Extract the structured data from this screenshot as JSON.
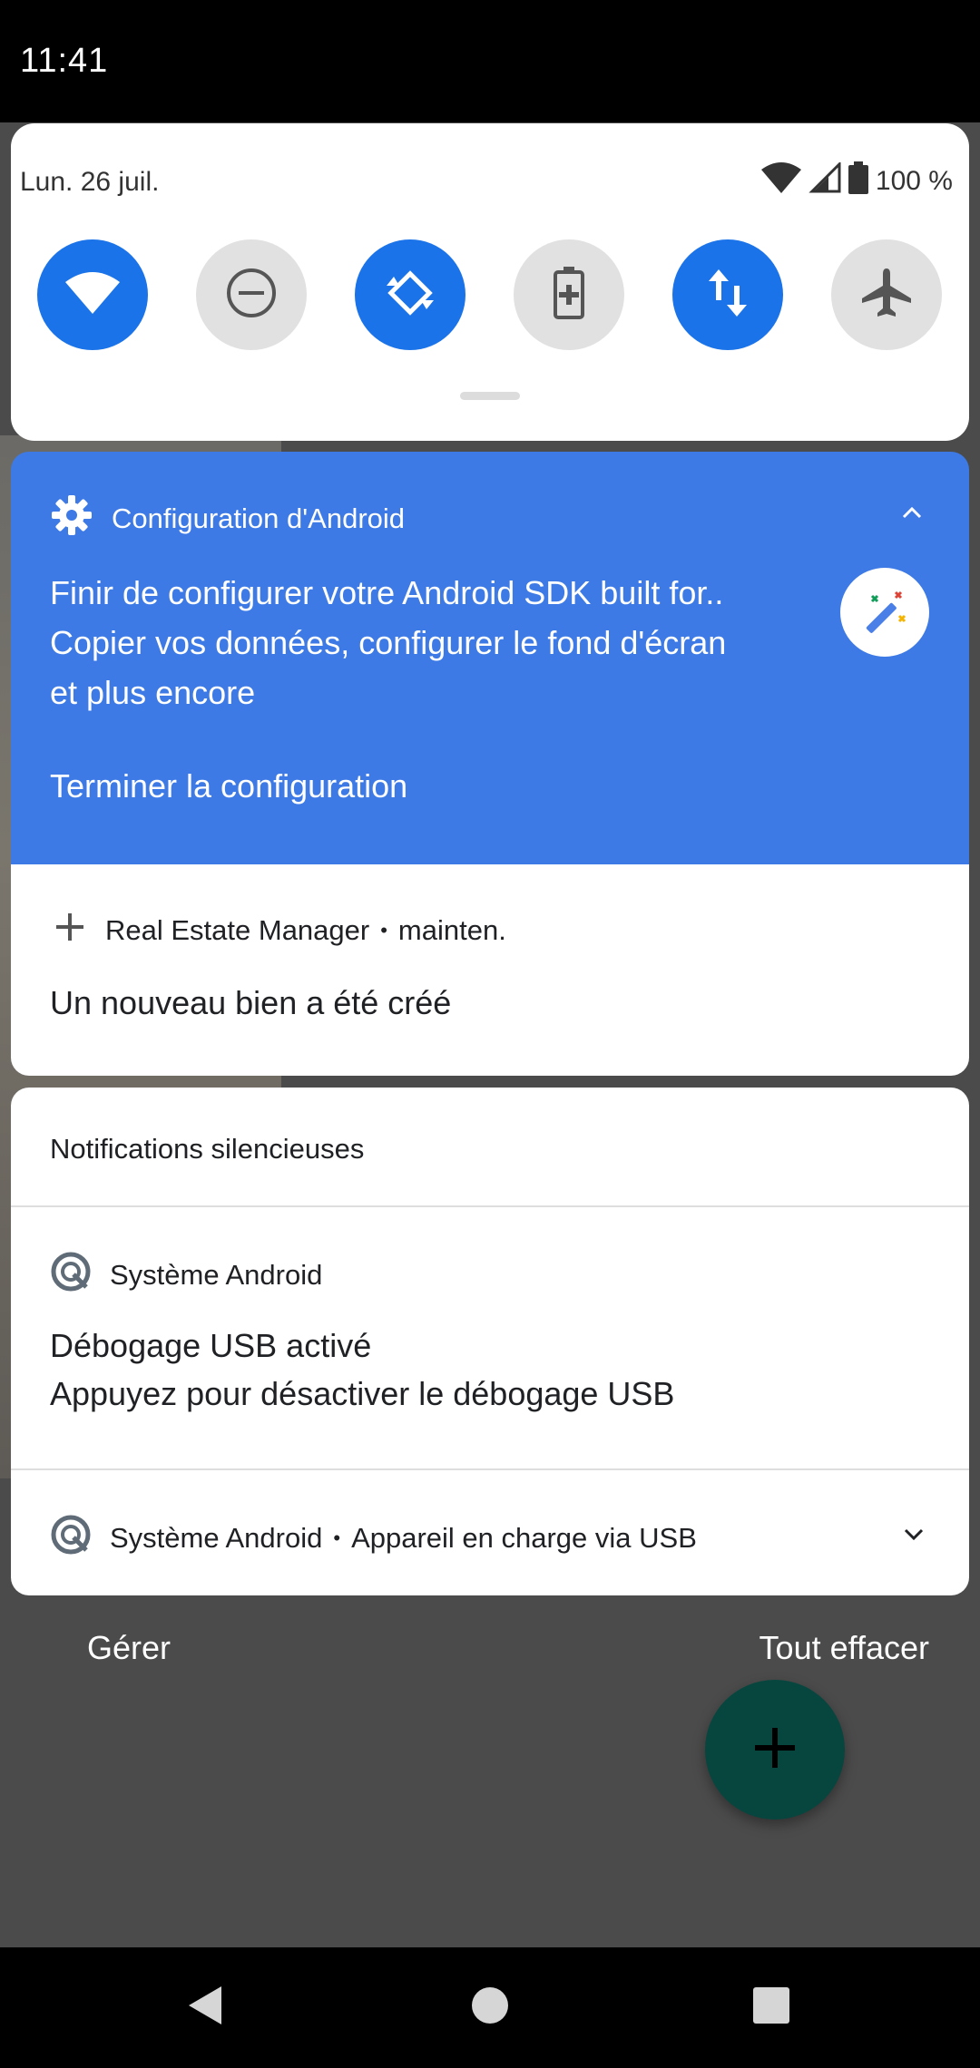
{
  "status_bar": {
    "time": "11:41"
  },
  "quick_settings": {
    "date": "Lun. 26 juil.",
    "battery": "100 %",
    "tiles": [
      {
        "name": "wifi",
        "icon": "wifi-icon",
        "active": true
      },
      {
        "name": "do-not-disturb",
        "icon": "minus-circle-icon",
        "active": false
      },
      {
        "name": "auto-rotate",
        "icon": "rotate-icon",
        "active": true
      },
      {
        "name": "battery-saver",
        "icon": "battery-plus-icon",
        "active": false
      },
      {
        "name": "mobile-data",
        "icon": "data-arrows-icon",
        "active": true
      },
      {
        "name": "airplane-mode",
        "icon": "airplane-icon",
        "active": false
      }
    ]
  },
  "setup_notification": {
    "app": "Configuration d'Android",
    "line1": "Finir de configurer votre Android SDK built for..",
    "line2": "Copier vos données, configurer le fond d'écran",
    "line3": "et plus encore",
    "action": "Terminer la configuration",
    "icon": "magic-wand-icon"
  },
  "rem_notification": {
    "app": "Real Estate Manager",
    "time": "mainten.",
    "text": "Un nouveau bien a été créé"
  },
  "silent": {
    "title": "Notifications silencieuses",
    "usb_debug": {
      "app": "Système Android",
      "title": "Débogage USB activé",
      "text": "Appuyez pour désactiver le débogage USB"
    },
    "usb_charge": {
      "app": "Système Android",
      "text": "Appareil en charge via USB"
    }
  },
  "footer": {
    "manage": "Gérer",
    "clear_all": "Tout effacer"
  },
  "colors": {
    "accent": "#1a73e8",
    "setup_bg": "#3d7ae5",
    "fab": "#07463f"
  }
}
